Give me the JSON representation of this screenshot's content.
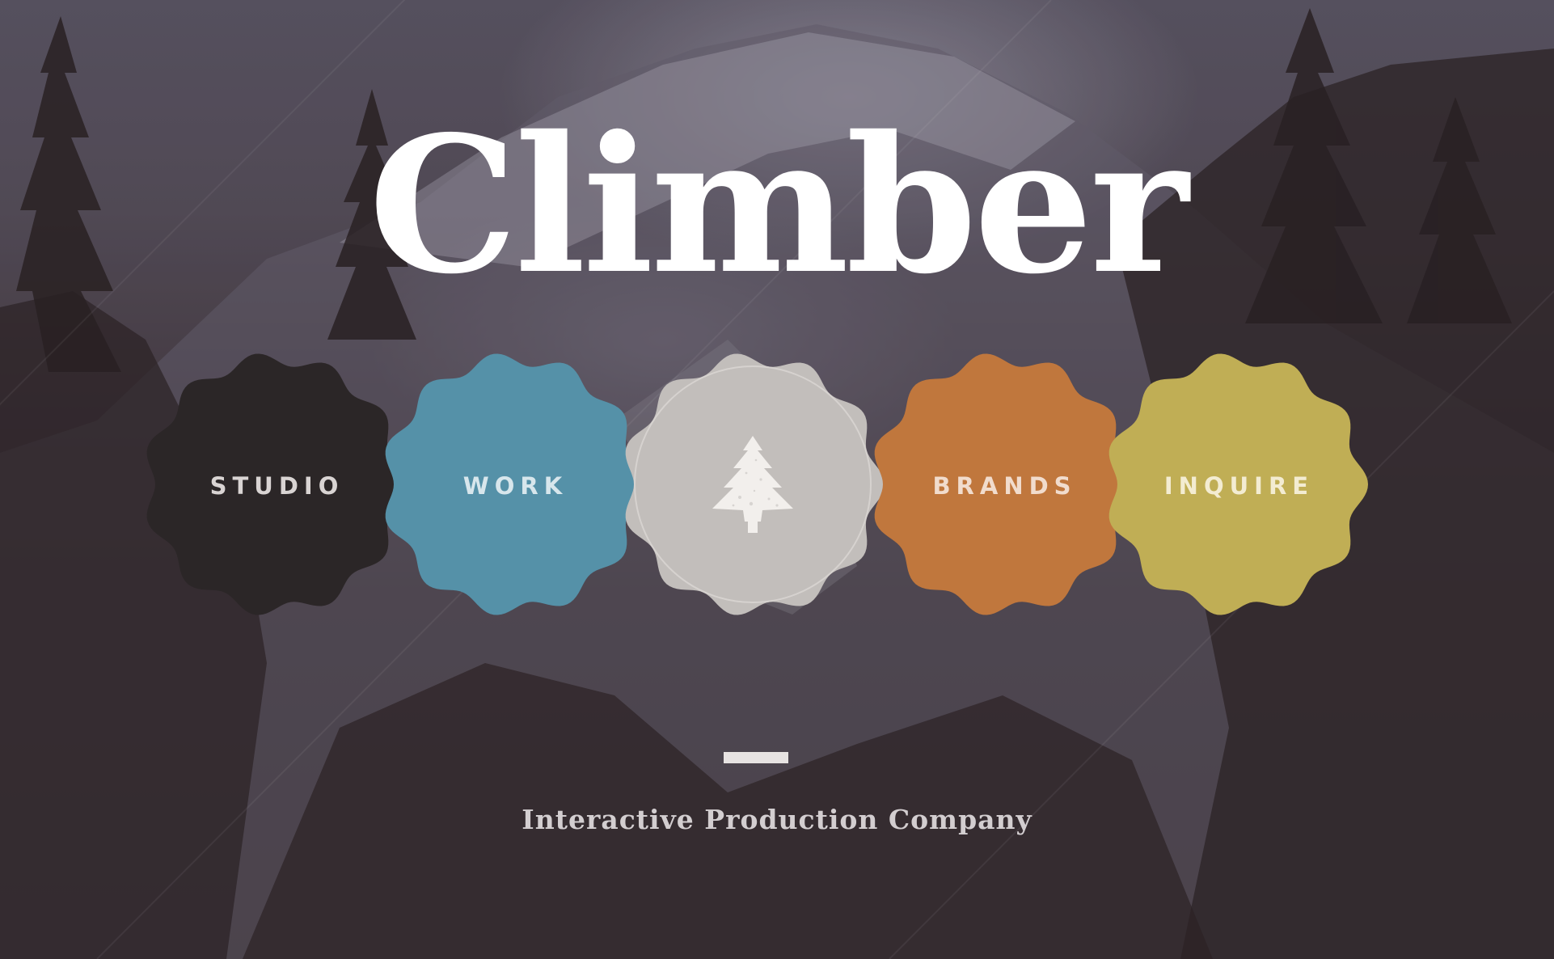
{
  "brand": {
    "title": "Climber",
    "tagline": "Interactive Production Company"
  },
  "nav": {
    "items": [
      {
        "label": "STUDIO",
        "color": "#2b2627",
        "text_color": "#d9d4d3"
      },
      {
        "label": "WORK",
        "color": "#5591a8",
        "text_color": "#d7e6ec"
      },
      {
        "label": "",
        "icon": "pine-tree-icon",
        "color": "#c2bebb",
        "text_color": "#f3f1ef"
      },
      {
        "label": "BRANDS",
        "color": "#c0773d",
        "text_color": "#f1dccd"
      },
      {
        "label": "INQUIRE",
        "color": "#c0ae55",
        "text_color": "#f3ecd2"
      }
    ]
  }
}
